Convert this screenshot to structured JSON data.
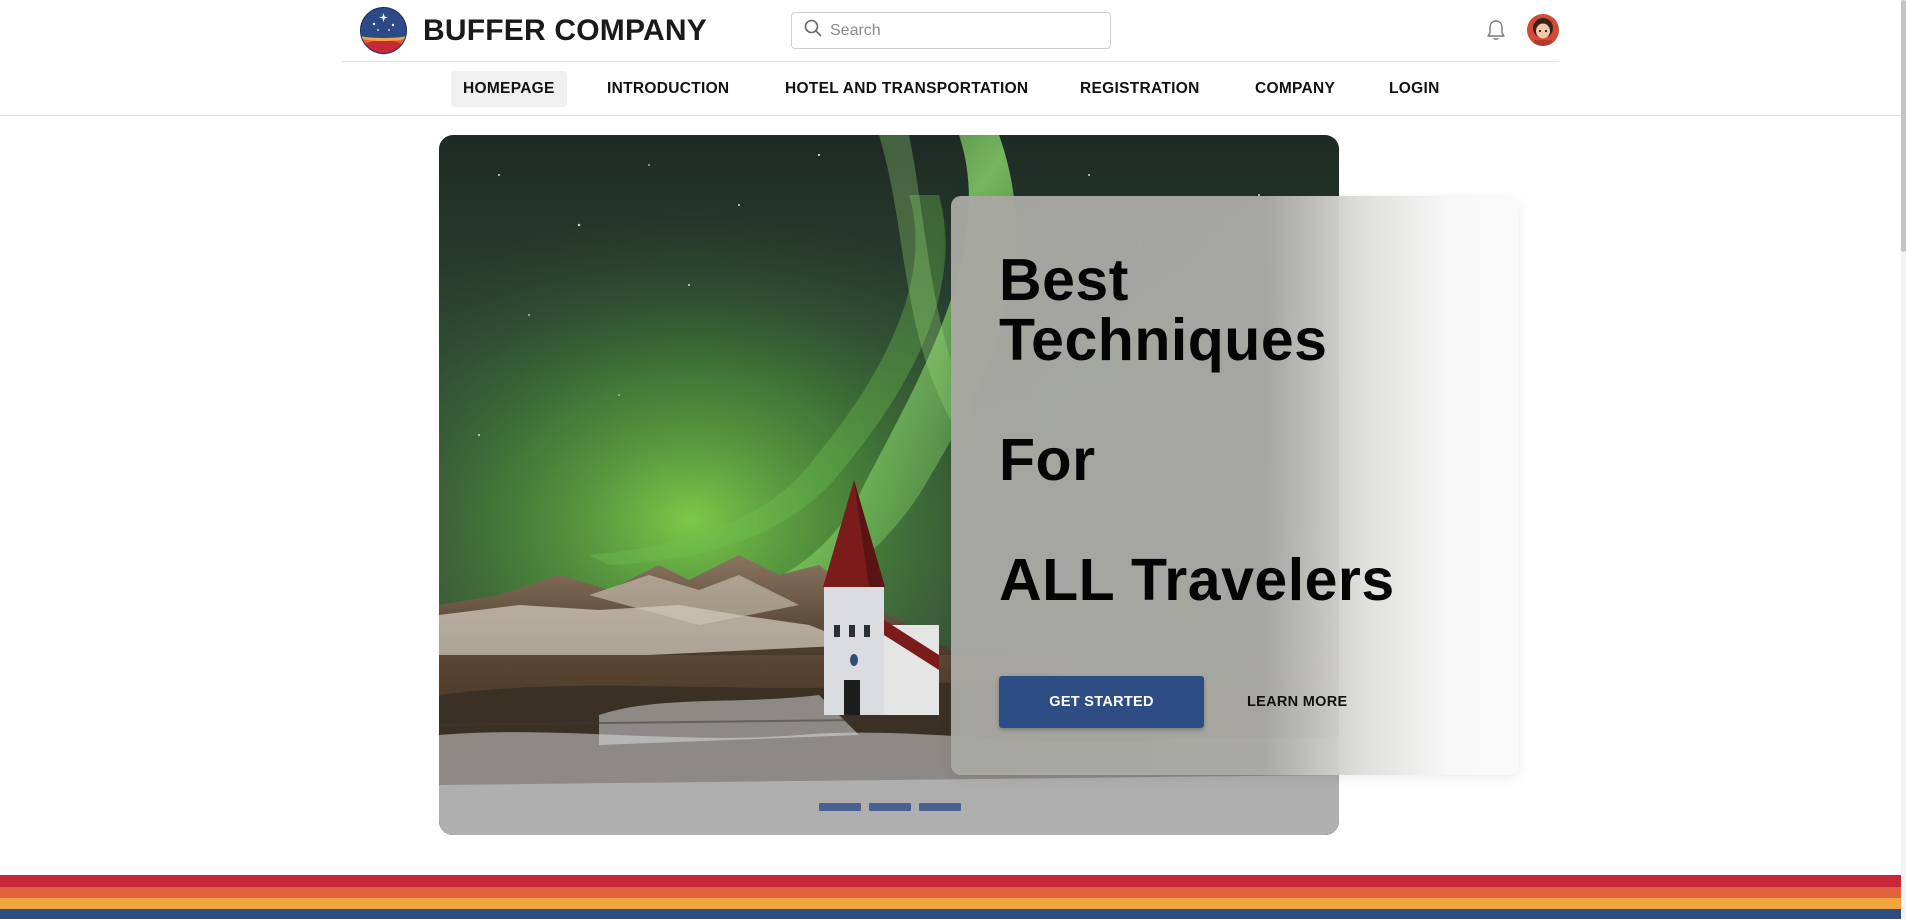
{
  "header": {
    "brand": "BUFFER COMPANY",
    "logo_icon": "starry-globe-logo",
    "search": {
      "placeholder": "Search",
      "icon": "search-icon"
    },
    "notification_icon": "bell-icon",
    "avatar_icon": "user-avatar"
  },
  "nav": {
    "items": [
      {
        "label": "HOMEPAGE",
        "active": true
      },
      {
        "label": "INTRODUCTION",
        "active": false
      },
      {
        "label": "HOTEL AND TRANSPORTATION",
        "active": false
      },
      {
        "label": "REGISTRATION",
        "active": false
      },
      {
        "label": "COMPANY",
        "active": false
      },
      {
        "label": "LOGIN",
        "active": false
      }
    ]
  },
  "hero": {
    "image": "aurora-over-church-photo",
    "headline": [
      "Best",
      "Techniques",
      "For",
      "ALL Travelers"
    ],
    "primary_button": "GET STARTED",
    "secondary_button": "LEARN MORE",
    "slides_count": 3,
    "active_slide": 1
  },
  "colors": {
    "primary": "#2f4d85",
    "stripes": [
      "#c8273a",
      "#e0613a",
      "#f0a640",
      "#2f4d85"
    ]
  }
}
